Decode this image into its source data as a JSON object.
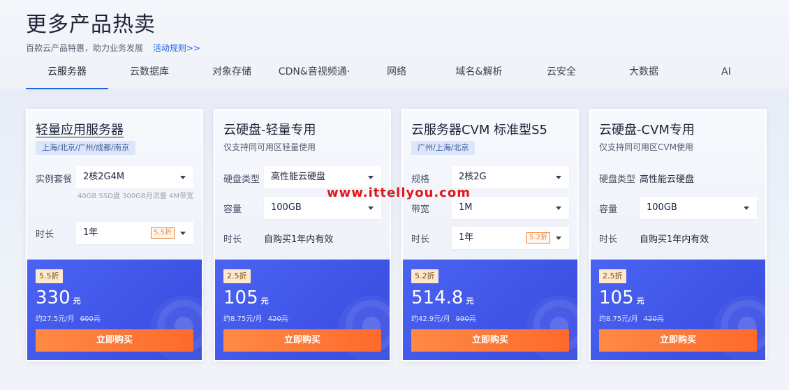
{
  "header": {
    "title": "更多产品热卖",
    "subtitle": "百款云产品特惠，助力业务发展",
    "rules_link": "活动规则>>"
  },
  "tabs": [
    {
      "label": "云服务器",
      "active": true
    },
    {
      "label": "云数据库"
    },
    {
      "label": "对象存储"
    },
    {
      "label": "CDN&音视频通·"
    },
    {
      "label": "网络"
    },
    {
      "label": "域名&解析"
    },
    {
      "label": "云安全"
    },
    {
      "label": "大数据"
    },
    {
      "label": "AI"
    }
  ],
  "cards": [
    {
      "name": "轻量应用服务器",
      "region": "上海/北京/广州/成都/南京",
      "rows": [
        {
          "label": "实例套餐",
          "value": "2核2G4M"
        },
        {
          "label": "时长",
          "value": "1年",
          "discount": "5.5折"
        }
      ],
      "hint": "40GB SSD盘 300GB月流量 4M带宽",
      "badge": "5.5折",
      "price": "330",
      "unit": "元",
      "monthly": "约27.5元/月",
      "original": "600元",
      "buy": "立即购买"
    },
    {
      "name": "云硬盘-轻量专用",
      "desc": "仅支持同可用区轻量使用",
      "rows": [
        {
          "label": "硬盘类型",
          "value": "高性能云硬盘"
        },
        {
          "label": "容量",
          "value": "100GB"
        },
        {
          "label": "时长",
          "value": "自购买1年内有效"
        }
      ],
      "badge": "2.5折",
      "price": "105",
      "unit": "元",
      "monthly": "约8.75元/月",
      "original": "420元",
      "buy": "立即购买"
    },
    {
      "name": "云服务器CVM 标准型S5",
      "region": "广州/上海/北京",
      "rows": [
        {
          "label": "规格",
          "value": "2核2G"
        },
        {
          "label": "带宽",
          "value": "1M"
        },
        {
          "label": "时长",
          "value": "1年",
          "discount": "5.2折"
        }
      ],
      "badge": "5.2折",
      "price": "514.8",
      "unit": "元",
      "monthly": "约42.9元/月",
      "original": "990元",
      "buy": "立即购买"
    },
    {
      "name": "云硬盘-CVM专用",
      "desc": "仅支持同可用区CVM使用",
      "rows": [
        {
          "label": "硬盘类型",
          "value": "高性能云硬盘"
        },
        {
          "label": "容量",
          "value": "100GB"
        },
        {
          "label": "时长",
          "value": "自购买1年内有效"
        }
      ],
      "badge": "2.5折",
      "price": "105",
      "unit": "元",
      "monthly": "约8.75元/月",
      "original": "420元",
      "buy": "立即购买"
    }
  ],
  "watermark": "www.ittellyou.com",
  "colors": {
    "accent": "#1f64e6",
    "card_bottom": "#4259e8",
    "buy_button": "#fd6a2c",
    "discount": "#f07d2d",
    "watermark": "#e0161b"
  }
}
